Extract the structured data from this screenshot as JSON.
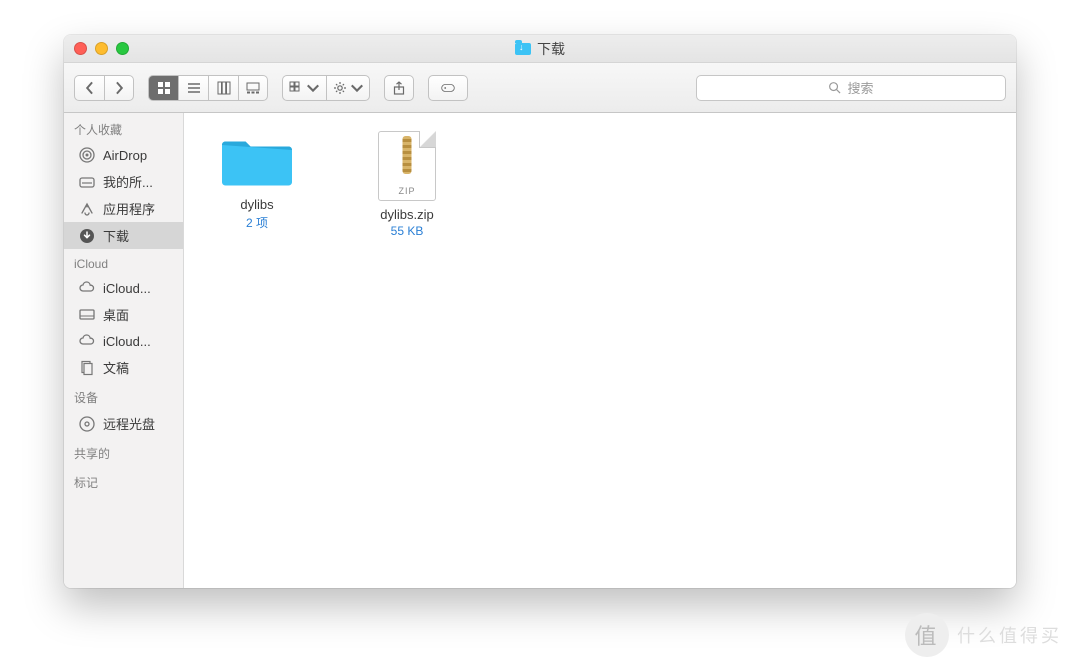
{
  "window": {
    "title": "下载"
  },
  "toolbar": {
    "search_placeholder": "搜索"
  },
  "sidebar": {
    "sections": [
      {
        "header": "个人收藏",
        "items": [
          {
            "icon": "airdrop",
            "label": "AirDrop",
            "selected": false
          },
          {
            "icon": "all-files",
            "label": "我的所...",
            "selected": false
          },
          {
            "icon": "apps",
            "label": "应用程序",
            "selected": false
          },
          {
            "icon": "downloads",
            "label": "下载",
            "selected": true
          }
        ]
      },
      {
        "header": "iCloud",
        "items": [
          {
            "icon": "icloud",
            "label": "iCloud...",
            "selected": false
          },
          {
            "icon": "desktop",
            "label": "桌面",
            "selected": false
          },
          {
            "icon": "icloud",
            "label": "iCloud...",
            "selected": false
          },
          {
            "icon": "documents",
            "label": "文稿",
            "selected": false
          }
        ]
      },
      {
        "header": "设备",
        "items": [
          {
            "icon": "disc",
            "label": "远程光盘",
            "selected": false
          }
        ]
      },
      {
        "header": "共享的",
        "items": []
      },
      {
        "header": "标记",
        "items": []
      }
    ]
  },
  "files": [
    {
      "kind": "folder",
      "name": "dylibs",
      "meta": "2 项"
    },
    {
      "kind": "zip",
      "name": "dylibs.zip",
      "meta": "55 KB",
      "badge": "ZIP"
    }
  ],
  "watermark": {
    "badge": "值",
    "text": "什么值得买"
  }
}
